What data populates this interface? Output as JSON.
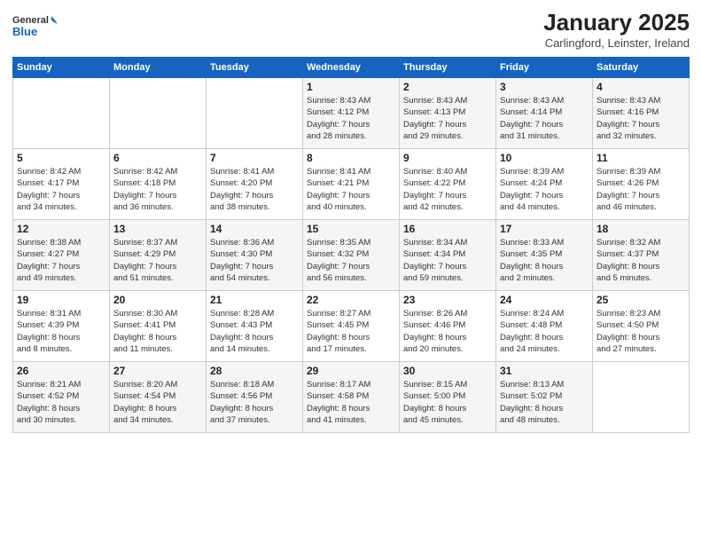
{
  "logo": {
    "general": "General",
    "blue": "Blue"
  },
  "title": "January 2025",
  "location": "Carlingford, Leinster, Ireland",
  "days_header": [
    "Sunday",
    "Monday",
    "Tuesday",
    "Wednesday",
    "Thursday",
    "Friday",
    "Saturday"
  ],
  "weeks": [
    [
      {
        "day": "",
        "info": ""
      },
      {
        "day": "",
        "info": ""
      },
      {
        "day": "",
        "info": ""
      },
      {
        "day": "1",
        "info": "Sunrise: 8:43 AM\nSunset: 4:12 PM\nDaylight: 7 hours\nand 28 minutes."
      },
      {
        "day": "2",
        "info": "Sunrise: 8:43 AM\nSunset: 4:13 PM\nDaylight: 7 hours\nand 29 minutes."
      },
      {
        "day": "3",
        "info": "Sunrise: 8:43 AM\nSunset: 4:14 PM\nDaylight: 7 hours\nand 31 minutes."
      },
      {
        "day": "4",
        "info": "Sunrise: 8:43 AM\nSunset: 4:16 PM\nDaylight: 7 hours\nand 32 minutes."
      }
    ],
    [
      {
        "day": "5",
        "info": "Sunrise: 8:42 AM\nSunset: 4:17 PM\nDaylight: 7 hours\nand 34 minutes."
      },
      {
        "day": "6",
        "info": "Sunrise: 8:42 AM\nSunset: 4:18 PM\nDaylight: 7 hours\nand 36 minutes."
      },
      {
        "day": "7",
        "info": "Sunrise: 8:41 AM\nSunset: 4:20 PM\nDaylight: 7 hours\nand 38 minutes."
      },
      {
        "day": "8",
        "info": "Sunrise: 8:41 AM\nSunset: 4:21 PM\nDaylight: 7 hours\nand 40 minutes."
      },
      {
        "day": "9",
        "info": "Sunrise: 8:40 AM\nSunset: 4:22 PM\nDaylight: 7 hours\nand 42 minutes."
      },
      {
        "day": "10",
        "info": "Sunrise: 8:39 AM\nSunset: 4:24 PM\nDaylight: 7 hours\nand 44 minutes."
      },
      {
        "day": "11",
        "info": "Sunrise: 8:39 AM\nSunset: 4:26 PM\nDaylight: 7 hours\nand 46 minutes."
      }
    ],
    [
      {
        "day": "12",
        "info": "Sunrise: 8:38 AM\nSunset: 4:27 PM\nDaylight: 7 hours\nand 49 minutes."
      },
      {
        "day": "13",
        "info": "Sunrise: 8:37 AM\nSunset: 4:29 PM\nDaylight: 7 hours\nand 51 minutes."
      },
      {
        "day": "14",
        "info": "Sunrise: 8:36 AM\nSunset: 4:30 PM\nDaylight: 7 hours\nand 54 minutes."
      },
      {
        "day": "15",
        "info": "Sunrise: 8:35 AM\nSunset: 4:32 PM\nDaylight: 7 hours\nand 56 minutes."
      },
      {
        "day": "16",
        "info": "Sunrise: 8:34 AM\nSunset: 4:34 PM\nDaylight: 7 hours\nand 59 minutes."
      },
      {
        "day": "17",
        "info": "Sunrise: 8:33 AM\nSunset: 4:35 PM\nDaylight: 8 hours\nand 2 minutes."
      },
      {
        "day": "18",
        "info": "Sunrise: 8:32 AM\nSunset: 4:37 PM\nDaylight: 8 hours\nand 5 minutes."
      }
    ],
    [
      {
        "day": "19",
        "info": "Sunrise: 8:31 AM\nSunset: 4:39 PM\nDaylight: 8 hours\nand 8 minutes."
      },
      {
        "day": "20",
        "info": "Sunrise: 8:30 AM\nSunset: 4:41 PM\nDaylight: 8 hours\nand 11 minutes."
      },
      {
        "day": "21",
        "info": "Sunrise: 8:28 AM\nSunset: 4:43 PM\nDaylight: 8 hours\nand 14 minutes."
      },
      {
        "day": "22",
        "info": "Sunrise: 8:27 AM\nSunset: 4:45 PM\nDaylight: 8 hours\nand 17 minutes."
      },
      {
        "day": "23",
        "info": "Sunrise: 8:26 AM\nSunset: 4:46 PM\nDaylight: 8 hours\nand 20 minutes."
      },
      {
        "day": "24",
        "info": "Sunrise: 8:24 AM\nSunset: 4:48 PM\nDaylight: 8 hours\nand 24 minutes."
      },
      {
        "day": "25",
        "info": "Sunrise: 8:23 AM\nSunset: 4:50 PM\nDaylight: 8 hours\nand 27 minutes."
      }
    ],
    [
      {
        "day": "26",
        "info": "Sunrise: 8:21 AM\nSunset: 4:52 PM\nDaylight: 8 hours\nand 30 minutes."
      },
      {
        "day": "27",
        "info": "Sunrise: 8:20 AM\nSunset: 4:54 PM\nDaylight: 8 hours\nand 34 minutes."
      },
      {
        "day": "28",
        "info": "Sunrise: 8:18 AM\nSunset: 4:56 PM\nDaylight: 8 hours\nand 37 minutes."
      },
      {
        "day": "29",
        "info": "Sunrise: 8:17 AM\nSunset: 4:58 PM\nDaylight: 8 hours\nand 41 minutes."
      },
      {
        "day": "30",
        "info": "Sunrise: 8:15 AM\nSunset: 5:00 PM\nDaylight: 8 hours\nand 45 minutes."
      },
      {
        "day": "31",
        "info": "Sunrise: 8:13 AM\nSunset: 5:02 PM\nDaylight: 8 hours\nand 48 minutes."
      },
      {
        "day": "",
        "info": ""
      }
    ]
  ]
}
